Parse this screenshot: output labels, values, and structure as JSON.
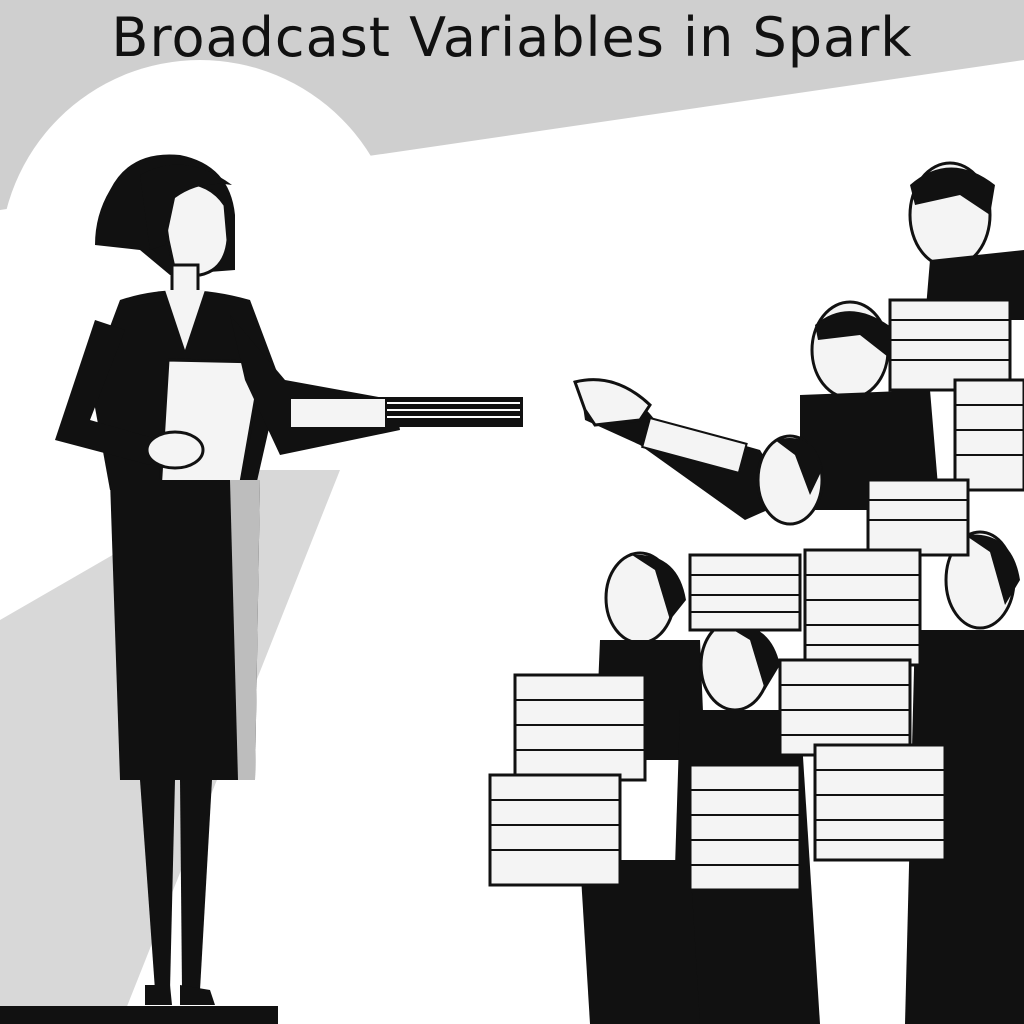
{
  "title": "Broadcast Variables in Spark",
  "palette": {
    "ink": "#111111",
    "light_gray": "#cfcfcf",
    "mid_gray": "#bdbdbd",
    "paper": "#ffffff",
    "skin": "#f4f4f4"
  },
  "scene": {
    "presenter": "woman-in-black-suit-handing-paper-stack",
    "recipients": "group-of-workers-holding-paper-stacks",
    "background": "spotlight-and-light-beam"
  }
}
